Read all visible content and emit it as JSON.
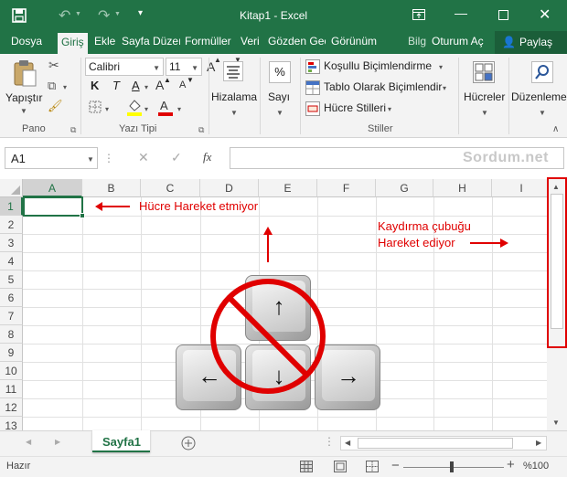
{
  "window": {
    "title": "Kitap1 - Excel"
  },
  "tabs": [
    {
      "label": "Dosya"
    },
    {
      "label": "Giriş"
    },
    {
      "label": "Ekle"
    },
    {
      "label": "Sayfa Düzeı"
    },
    {
      "label": "Formüller"
    },
    {
      "label": "Veri"
    },
    {
      "label": "Gözden Geç"
    },
    {
      "label": "Görünüm"
    }
  ],
  "tellme": {
    "label": "Bilg"
  },
  "account": {
    "label": "Oturum Aç"
  },
  "share": {
    "label": "Paylaş"
  },
  "ribbon": {
    "pano": {
      "paste_label": "Yapıştır",
      "group_label": "Pano"
    },
    "font": {
      "name": "Calibri",
      "size": "11",
      "bold": "K",
      "italic": "T",
      "underline": "A",
      "grow": "A",
      "shrink": "A",
      "group_label": "Yazı Tipi"
    },
    "alignment": {
      "label": "Hizalama"
    },
    "number": {
      "label": "Sayı",
      "symbol": "%"
    },
    "styles": {
      "conditional": "Koşullu Biçimlendirme",
      "table": "Tablo Olarak Biçimlendir",
      "cell_styles": "Hücre Stilleri",
      "group_label": "Stiller"
    },
    "cells": {
      "label": "Hücreler"
    },
    "editing": {
      "label": "Düzenleme"
    }
  },
  "formula_bar": {
    "name_box": "A1",
    "fx": "fx",
    "watermark": "Sordum.net"
  },
  "grid": {
    "columns": [
      "A",
      "B",
      "C",
      "D",
      "E",
      "F",
      "G",
      "H",
      "I"
    ],
    "rows": [
      "1",
      "2",
      "3",
      "4",
      "5",
      "6",
      "7",
      "8",
      "9",
      "10",
      "11",
      "12",
      "13"
    ],
    "active_cell": "A1"
  },
  "annotations": {
    "cell_note": "Hücre Hareket etmiyor",
    "scroll_note_line1": "Kaydırma çubuğu",
    "scroll_note_line2": "Hareket ediyor",
    "accent_color": "#e00000"
  },
  "sheets": [
    {
      "label": "Sayfa1"
    }
  ],
  "status": {
    "ready": "Hazır",
    "zoom": "%100"
  },
  "colors": {
    "excel_green": "#217346",
    "ribbon_bg": "#f3f3f3"
  }
}
